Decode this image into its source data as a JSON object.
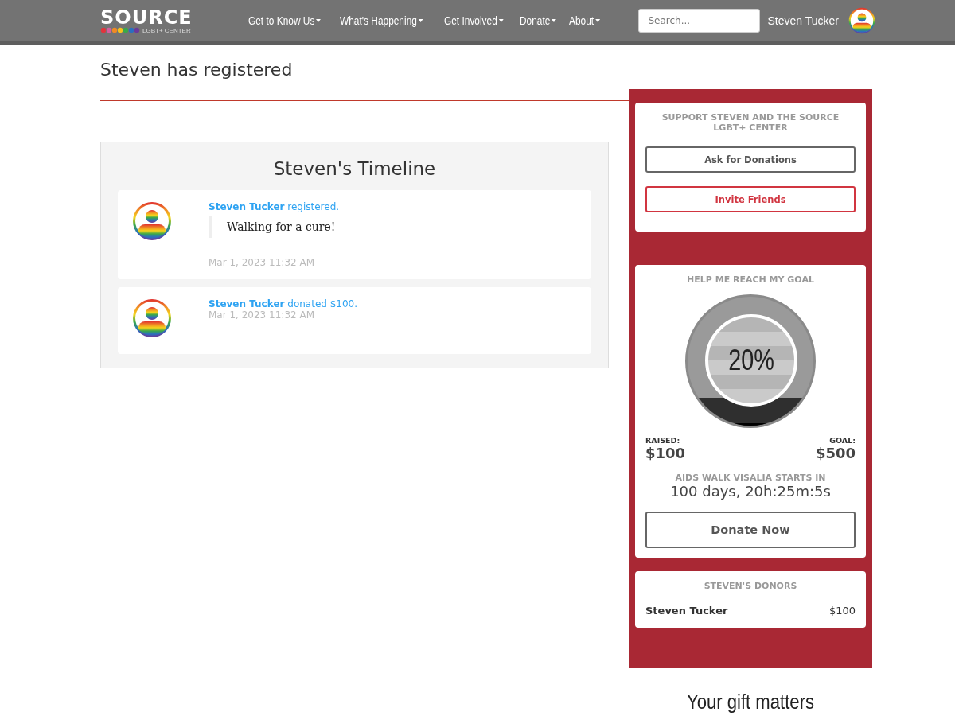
{
  "header": {
    "logo": {
      "word": "SOURCE",
      "subtitle": "LGBT+ CENTER"
    },
    "nav": [
      {
        "label": "Get to Know Us"
      },
      {
        "label": "What's Happening"
      },
      {
        "label": "Get Involved"
      },
      {
        "label": "Donate"
      },
      {
        "label": "About"
      }
    ],
    "search": {
      "placeholder": "Search..."
    },
    "user_name": "Steven Tucker"
  },
  "page_title": "Steven has registered",
  "timeline": {
    "title": "Steven's Timeline",
    "entries": [
      {
        "name": "Steven Tucker",
        "action": "registered.",
        "quote": "Walking for a cure!",
        "time": "Mar 1, 2023 11:32 AM"
      },
      {
        "name": "Steven Tucker",
        "action": "donated $100.",
        "time": "Mar 1, 2023 11:32 AM"
      }
    ]
  },
  "support": {
    "title": "SUPPORT STEVEN AND THE SOURCE LGBT+ CENTER",
    "buttons": [
      {
        "label": "Ask for Donations",
        "kind": "neutral"
      },
      {
        "label": "Invite Friends",
        "kind": "accent"
      }
    ]
  },
  "goal": {
    "title": "HELP ME REACH MY GOAL",
    "percent": "20%",
    "level": 0.2,
    "raised_label": "RAISED:",
    "raised": "$100",
    "goal_label": "GOAL:",
    "goal": "$500",
    "countdown_label": "AIDS WALK VISALIA STARTS IN",
    "countdown": "100 days, 20h:25m:5s",
    "button": "Donate Now"
  },
  "donors": {
    "title": "STEVEN'S DONORS",
    "rows": [
      {
        "name": "Steven Tucker",
        "amount": "$100"
      }
    ]
  },
  "gift_heading": "Your gift matters"
}
